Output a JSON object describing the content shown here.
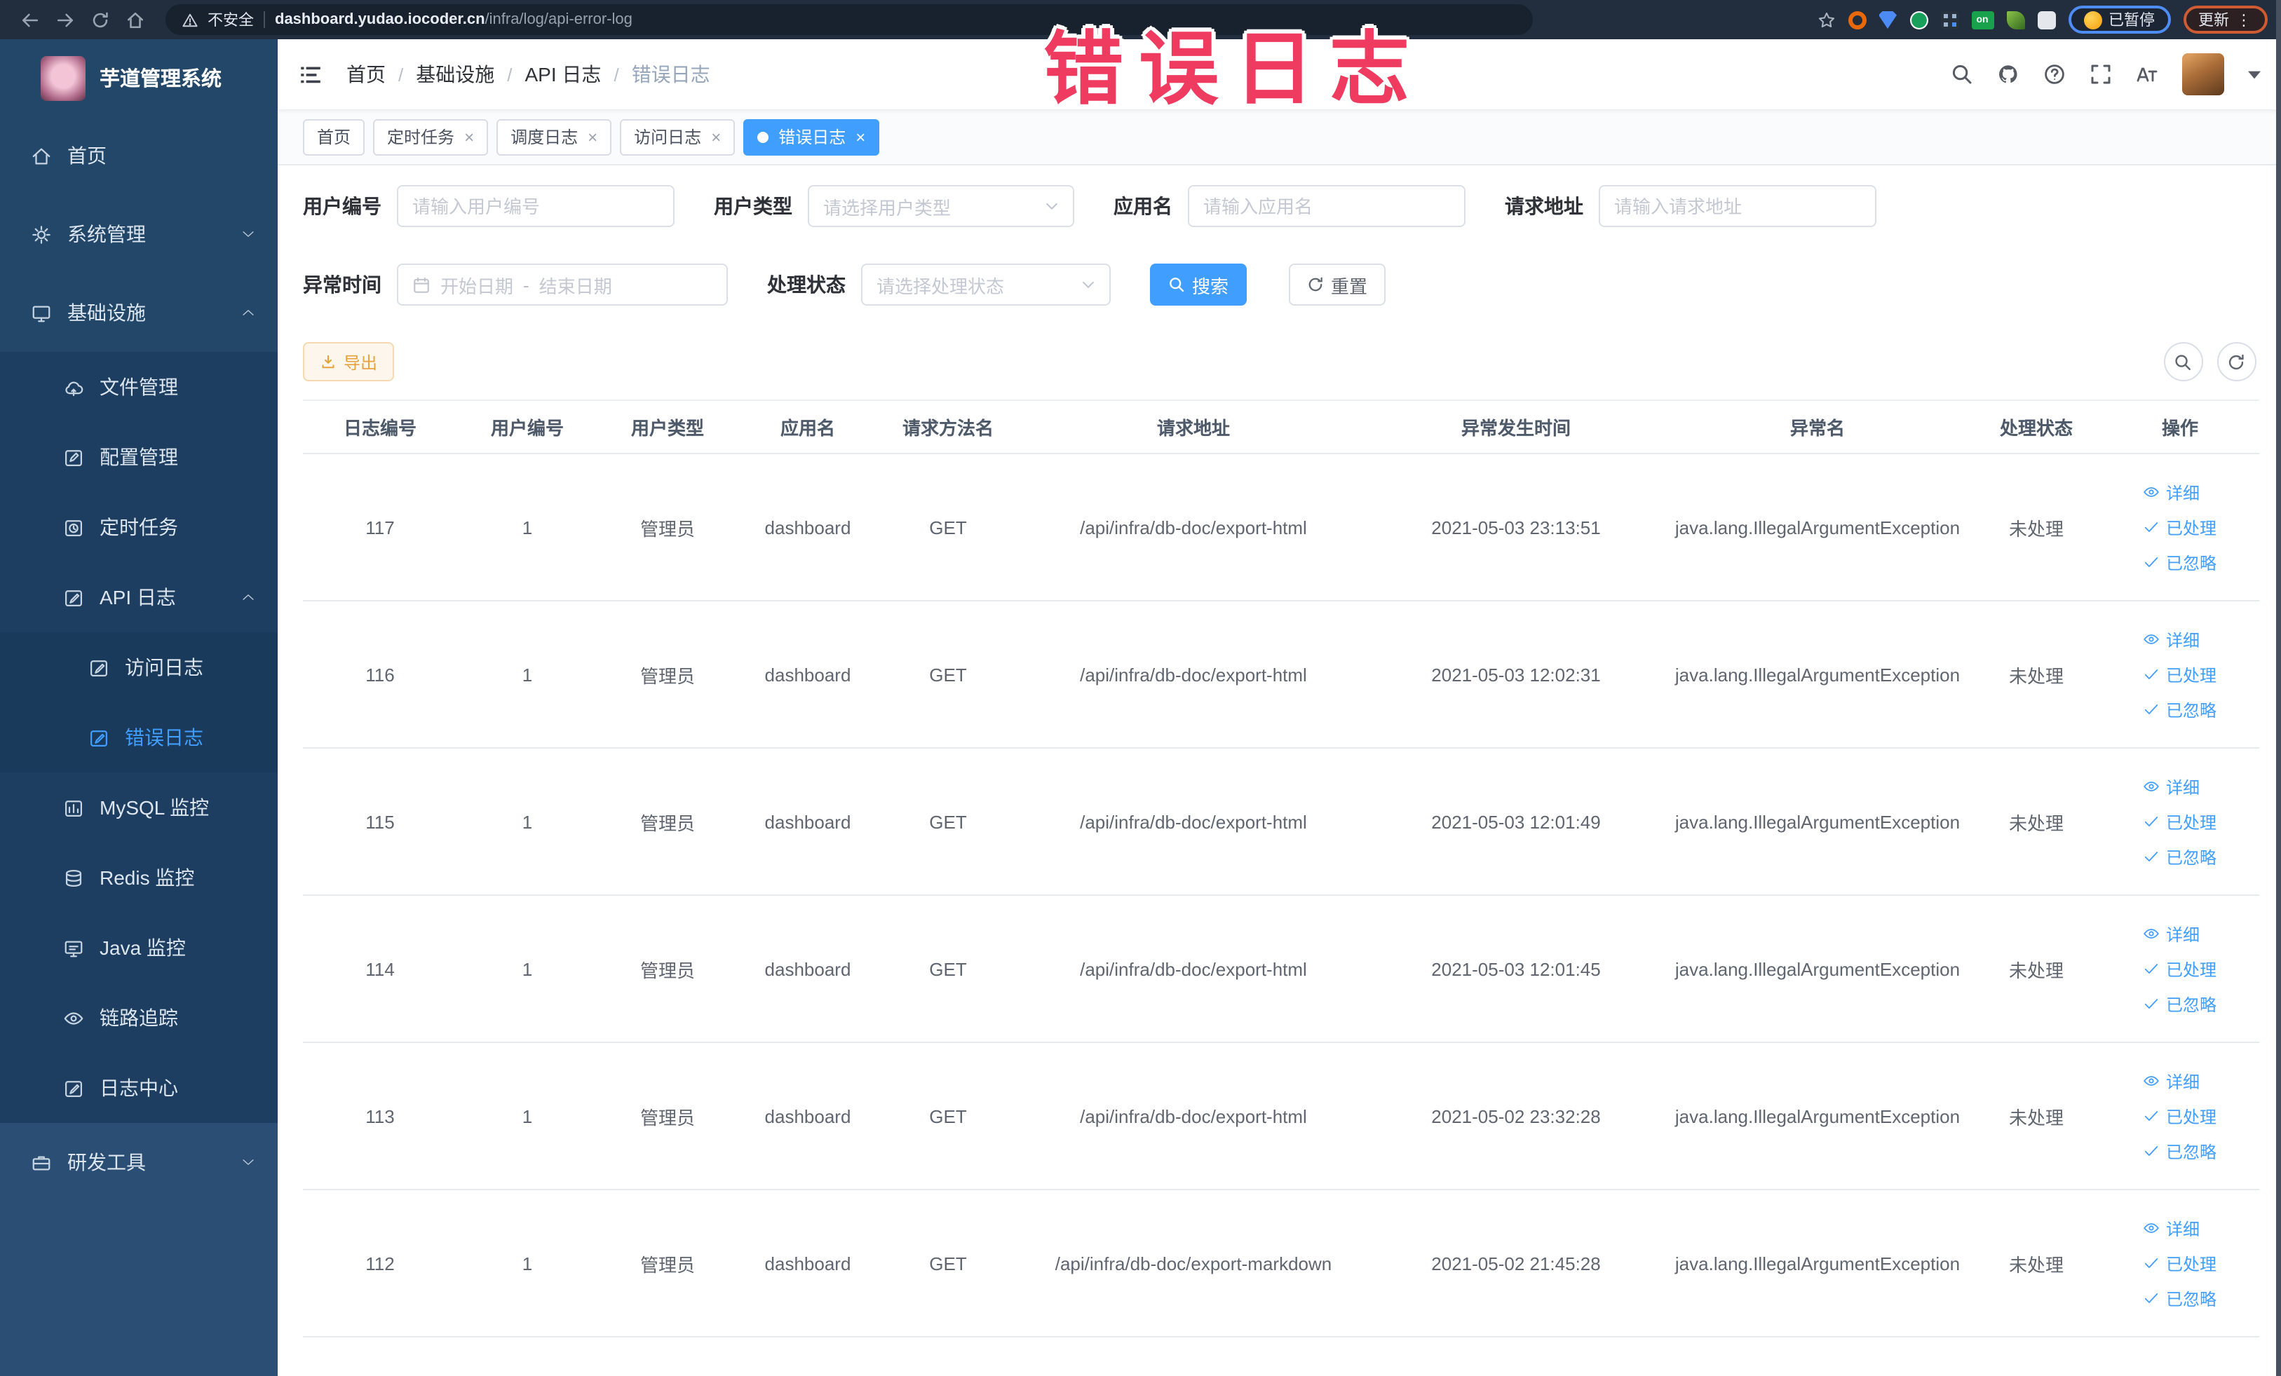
{
  "browser": {
    "security_label": "不安全",
    "url_host": "dashboard.yudao.iocoder.cn",
    "url_path": "/infra/log/api-error-log",
    "extensions": [
      {
        "kind": "ext-orange"
      },
      {
        "kind": "ext-shield"
      },
      {
        "kind": "ext-green"
      },
      {
        "kind": "ext-grid"
      },
      {
        "kind": "ext-on",
        "label": "on"
      },
      {
        "kind": "ext-leaf"
      },
      {
        "kind": "ext-puzzle"
      }
    ],
    "paused_label": "已暂停",
    "update_label": "更新"
  },
  "overlay": {
    "text": "错误日志",
    "color": "#ef3b60"
  },
  "sidebar": {
    "title": "芋道管理系统",
    "items": [
      {
        "label": "首页",
        "icon": "home-icon",
        "level": 1,
        "arrow": "",
        "active": false
      },
      {
        "label": "系统管理",
        "icon": "gear-icon",
        "level": 1,
        "arrow": "down",
        "active": false
      },
      {
        "label": "基础设施",
        "icon": "monitor-icon",
        "level": 1,
        "arrow": "up",
        "active": false
      },
      {
        "label": "文件管理",
        "icon": "cloud-icon",
        "level": 2,
        "arrow": "",
        "active": false
      },
      {
        "label": "配置管理",
        "icon": "edit-icon",
        "level": 2,
        "arrow": "",
        "active": false
      },
      {
        "label": "定时任务",
        "icon": "timer-icon",
        "level": 2,
        "arrow": "",
        "active": false
      },
      {
        "label": "API 日志",
        "icon": "log-icon",
        "level": 2,
        "arrow": "up",
        "active": false
      },
      {
        "label": "访问日志",
        "icon": "log-icon",
        "level": 3,
        "arrow": "",
        "active": false
      },
      {
        "label": "错误日志",
        "icon": "log-icon",
        "level": 3,
        "arrow": "",
        "active": true
      },
      {
        "label": "MySQL 监控",
        "icon": "chart-icon",
        "level": 2,
        "arrow": "",
        "active": false
      },
      {
        "label": "Redis 监控",
        "icon": "database-icon",
        "level": 2,
        "arrow": "",
        "active": false
      },
      {
        "label": "Java 监控",
        "icon": "java-icon",
        "level": 2,
        "arrow": "",
        "active": false
      },
      {
        "label": "链路追踪",
        "icon": "eye-icon",
        "level": 2,
        "arrow": "",
        "active": false
      },
      {
        "label": "日志中心",
        "icon": "log-icon",
        "level": 2,
        "arrow": "",
        "active": false
      },
      {
        "label": "研发工具",
        "icon": "briefcase-icon",
        "level": 1,
        "arrow": "down",
        "active": false,
        "section": "bottom"
      }
    ]
  },
  "breadcrumb": [
    "首页",
    "基础设施",
    "API 日志",
    "错误日志"
  ],
  "tabs": [
    {
      "label": "首页",
      "closable": false,
      "active": false
    },
    {
      "label": "定时任务",
      "closable": true,
      "active": false
    },
    {
      "label": "调度日志",
      "closable": true,
      "active": false
    },
    {
      "label": "访问日志",
      "closable": true,
      "active": false
    },
    {
      "label": "错误日志",
      "closable": true,
      "active": true
    }
  ],
  "filters": {
    "user_id": {
      "label": "用户编号",
      "placeholder": "请输入用户编号"
    },
    "user_type": {
      "label": "用户类型",
      "placeholder": "请选择用户类型"
    },
    "app_name": {
      "label": "应用名",
      "placeholder": "请输入应用名"
    },
    "request_url": {
      "label": "请求地址",
      "placeholder": "请输入请求地址"
    },
    "exception_time": {
      "label": "异常时间",
      "start_placeholder": "开始日期",
      "separator": "-",
      "end_placeholder": "结束日期"
    },
    "process_status": {
      "label": "处理状态",
      "placeholder": "请选择处理状态"
    },
    "search_label": "搜索",
    "reset_label": "重置"
  },
  "toolbar": {
    "export_label": "导出"
  },
  "table": {
    "headers": [
      "日志编号",
      "用户编号",
      "用户类型",
      "应用名",
      "请求方法名",
      "请求地址",
      "异常发生时间",
      "异常名",
      "处理状态",
      "操作"
    ],
    "actions": [
      "详细",
      "已处理",
      "已忽略"
    ],
    "rows": [
      {
        "id": "117",
        "user_id": "1",
        "user_type": "管理员",
        "app": "dashboard",
        "method": "GET",
        "url": "/api/infra/db-doc/export-html",
        "time": "2021-05-03 23:13:51",
        "exception": "java.lang.IllegalArgumentException",
        "status": "未处理"
      },
      {
        "id": "116",
        "user_id": "1",
        "user_type": "管理员",
        "app": "dashboard",
        "method": "GET",
        "url": "/api/infra/db-doc/export-html",
        "time": "2021-05-03 12:02:31",
        "exception": "java.lang.IllegalArgumentException",
        "status": "未处理"
      },
      {
        "id": "115",
        "user_id": "1",
        "user_type": "管理员",
        "app": "dashboard",
        "method": "GET",
        "url": "/api/infra/db-doc/export-html",
        "time": "2021-05-03 12:01:49",
        "exception": "java.lang.IllegalArgumentException",
        "status": "未处理"
      },
      {
        "id": "114",
        "user_id": "1",
        "user_type": "管理员",
        "app": "dashboard",
        "method": "GET",
        "url": "/api/infra/db-doc/export-html",
        "time": "2021-05-03 12:01:45",
        "exception": "java.lang.IllegalArgumentException",
        "status": "未处理"
      },
      {
        "id": "113",
        "user_id": "1",
        "user_type": "管理员",
        "app": "dashboard",
        "method": "GET",
        "url": "/api/infra/db-doc/export-html",
        "time": "2021-05-02 23:32:28",
        "exception": "java.lang.IllegalArgumentException",
        "status": "未处理"
      },
      {
        "id": "112",
        "user_id": "1",
        "user_type": "管理员",
        "app": "dashboard",
        "method": "GET",
        "url": "/api/infra/db-doc/export-markdown",
        "time": "2021-05-02 21:45:28",
        "exception": "java.lang.IllegalArgumentException",
        "status": "未处理"
      }
    ]
  },
  "colors": {
    "accent": "#409eff",
    "warning": "#e6a23c",
    "overlay_red": "#ef3b60",
    "sidebar_bg": "#224769"
  }
}
